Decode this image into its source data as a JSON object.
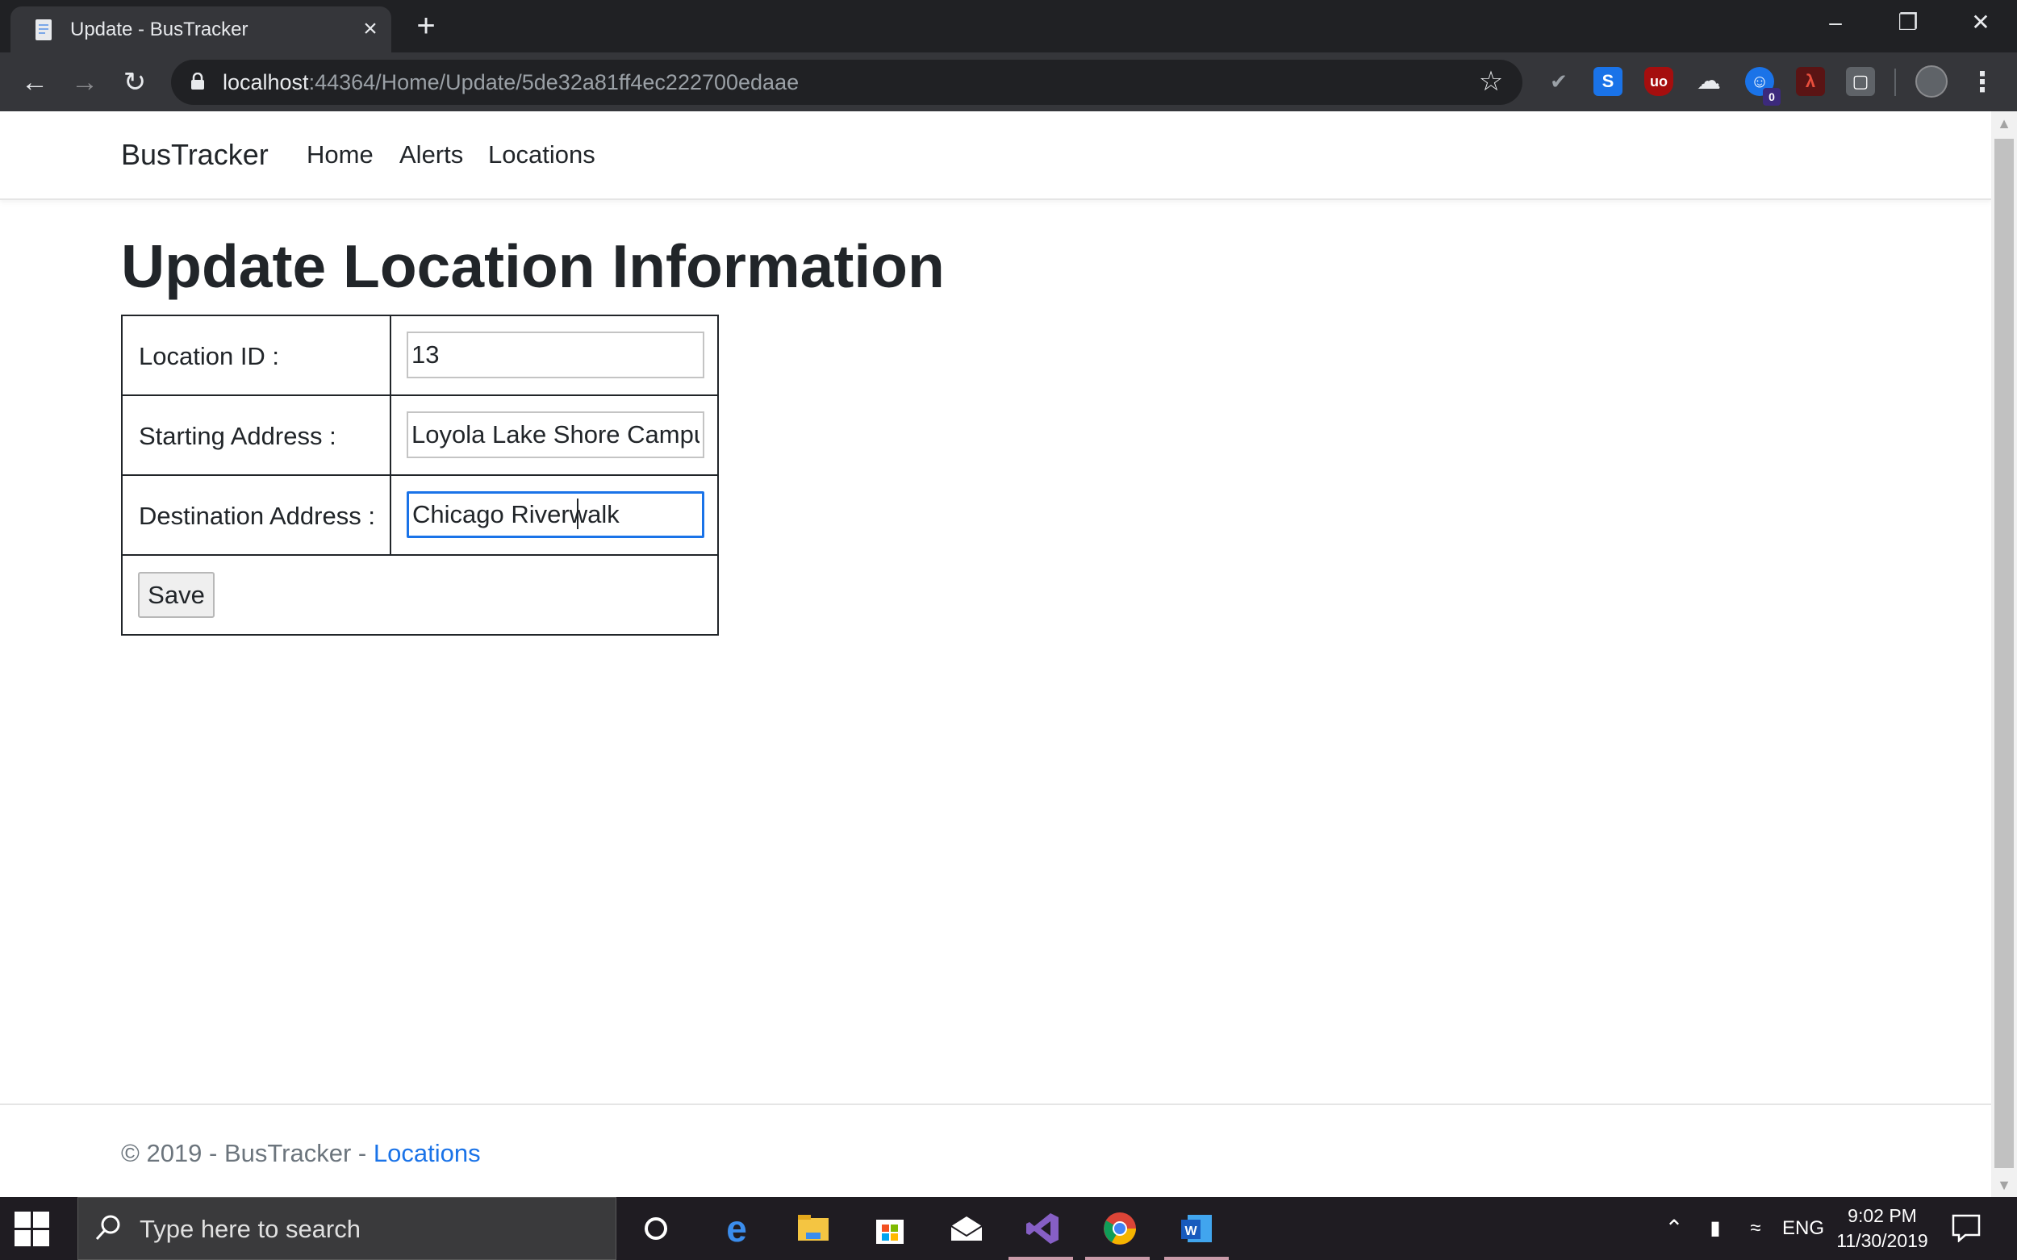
{
  "browser": {
    "tab_title": "Update - BusTracker",
    "url_host": "localhost",
    "url_path": ":44364/Home/Update/5de32a81ff4ec222700edaae",
    "extensions": [
      "script-icon",
      "s-icon",
      "ublock-icon",
      "clouds-icon",
      "ghost-icon",
      "acrobat-icon",
      "briefcase-icon"
    ],
    "extension_badge": "0"
  },
  "navbar": {
    "brand": "BusTracker",
    "links": [
      "Home",
      "Alerts",
      "Locations"
    ]
  },
  "page": {
    "title": "Update Location Information",
    "fields": [
      {
        "label": "Location ID :",
        "value": "13"
      },
      {
        "label": "Starting Address :",
        "value": "Loyola Lake Shore Campu"
      },
      {
        "label": "Destination Address :",
        "value": "Chicago Riverwalk"
      }
    ],
    "save_label": "Save"
  },
  "footer": {
    "text": "© 2019 - BusTracker - ",
    "link": "Locations"
  },
  "taskbar": {
    "search_placeholder": "Type here to search",
    "language": "ENG",
    "time": "9:02 PM",
    "date": "11/30/2019"
  },
  "colors": {
    "accent": "#1a73e8",
    "chrome_dark": "#202124",
    "chrome_toolbar": "#35363a",
    "text": "#212529",
    "muted": "#6c757d"
  }
}
